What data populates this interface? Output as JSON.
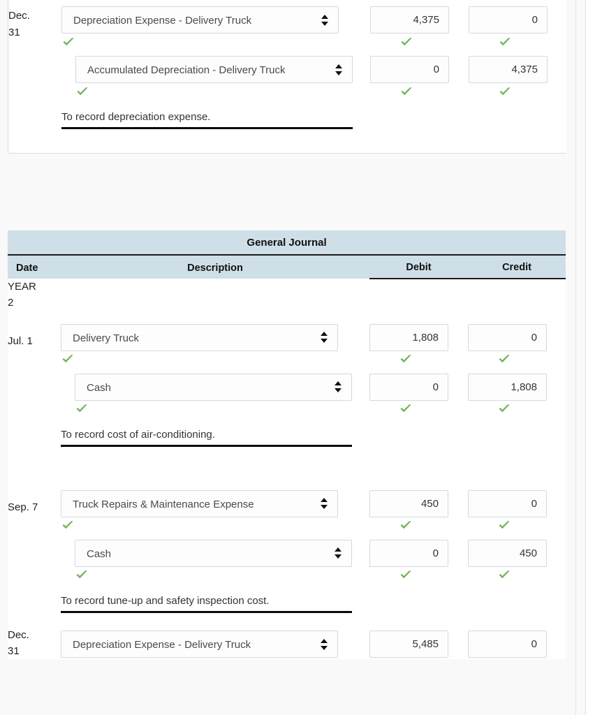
{
  "colors": {
    "header_blue": "#cfdfe8",
    "check_green": "#6fb357",
    "page_bg": "#f9f9f9",
    "border_gray": "#d5d9dc",
    "rule_black": "#0a0a0a"
  },
  "journal_top": {
    "entries": [
      {
        "date": "Dec.\n31",
        "date_line1": "Dec.",
        "date_line2": "31",
        "lines": [
          {
            "account": "Depreciation Expense - Delivery Truck",
            "indent": false,
            "debit": "4,375",
            "credit": "0",
            "account_ok": true,
            "debit_ok": true,
            "credit_ok": true
          },
          {
            "account": "Accumulated Depreciation - Delivery Truck",
            "indent": true,
            "debit": "0",
            "credit": "4,375",
            "account_ok": true,
            "debit_ok": true,
            "credit_ok": true
          }
        ],
        "memo": "To record depreciation expense."
      }
    ]
  },
  "journal_bottom": {
    "title": "General Journal",
    "columns": {
      "date": "Date",
      "description": "Description",
      "debit": "Debit",
      "credit": "Credit"
    },
    "year_label_line1": "YEAR",
    "year_label_line2": "2",
    "entries": [
      {
        "date": "Jul. 1",
        "lines": [
          {
            "account": "Delivery Truck",
            "indent": false,
            "debit": "1,808",
            "credit": "0",
            "account_ok": true,
            "debit_ok": true,
            "credit_ok": true
          },
          {
            "account": "Cash",
            "indent": true,
            "debit": "0",
            "credit": "1,808",
            "account_ok": true,
            "debit_ok": true,
            "credit_ok": true
          }
        ],
        "memo": "To record cost of air-conditioning."
      },
      {
        "date": "Sep. 7",
        "lines": [
          {
            "account": "Truck Repairs & Maintenance Expense",
            "indent": false,
            "debit": "450",
            "credit": "0",
            "account_ok": true,
            "debit_ok": true,
            "credit_ok": true
          },
          {
            "account": "Cash",
            "indent": true,
            "debit": "0",
            "credit": "450",
            "account_ok": true,
            "debit_ok": true,
            "credit_ok": true
          }
        ],
        "memo": "To record tune-up and safety inspection cost."
      },
      {
        "date": "Dec.",
        "date_line1": "Dec.",
        "date_line2": "31",
        "lines": [
          {
            "account": "Depreciation Expense - Delivery Truck",
            "indent": false,
            "debit": "5,485",
            "credit": "0",
            "account_ok": false,
            "debit_ok": false,
            "credit_ok": false
          }
        ],
        "memo": ""
      }
    ]
  },
  "icons": {
    "select_spinner": "updown-arrows-icon",
    "valid_mark": "green-check-icon"
  }
}
